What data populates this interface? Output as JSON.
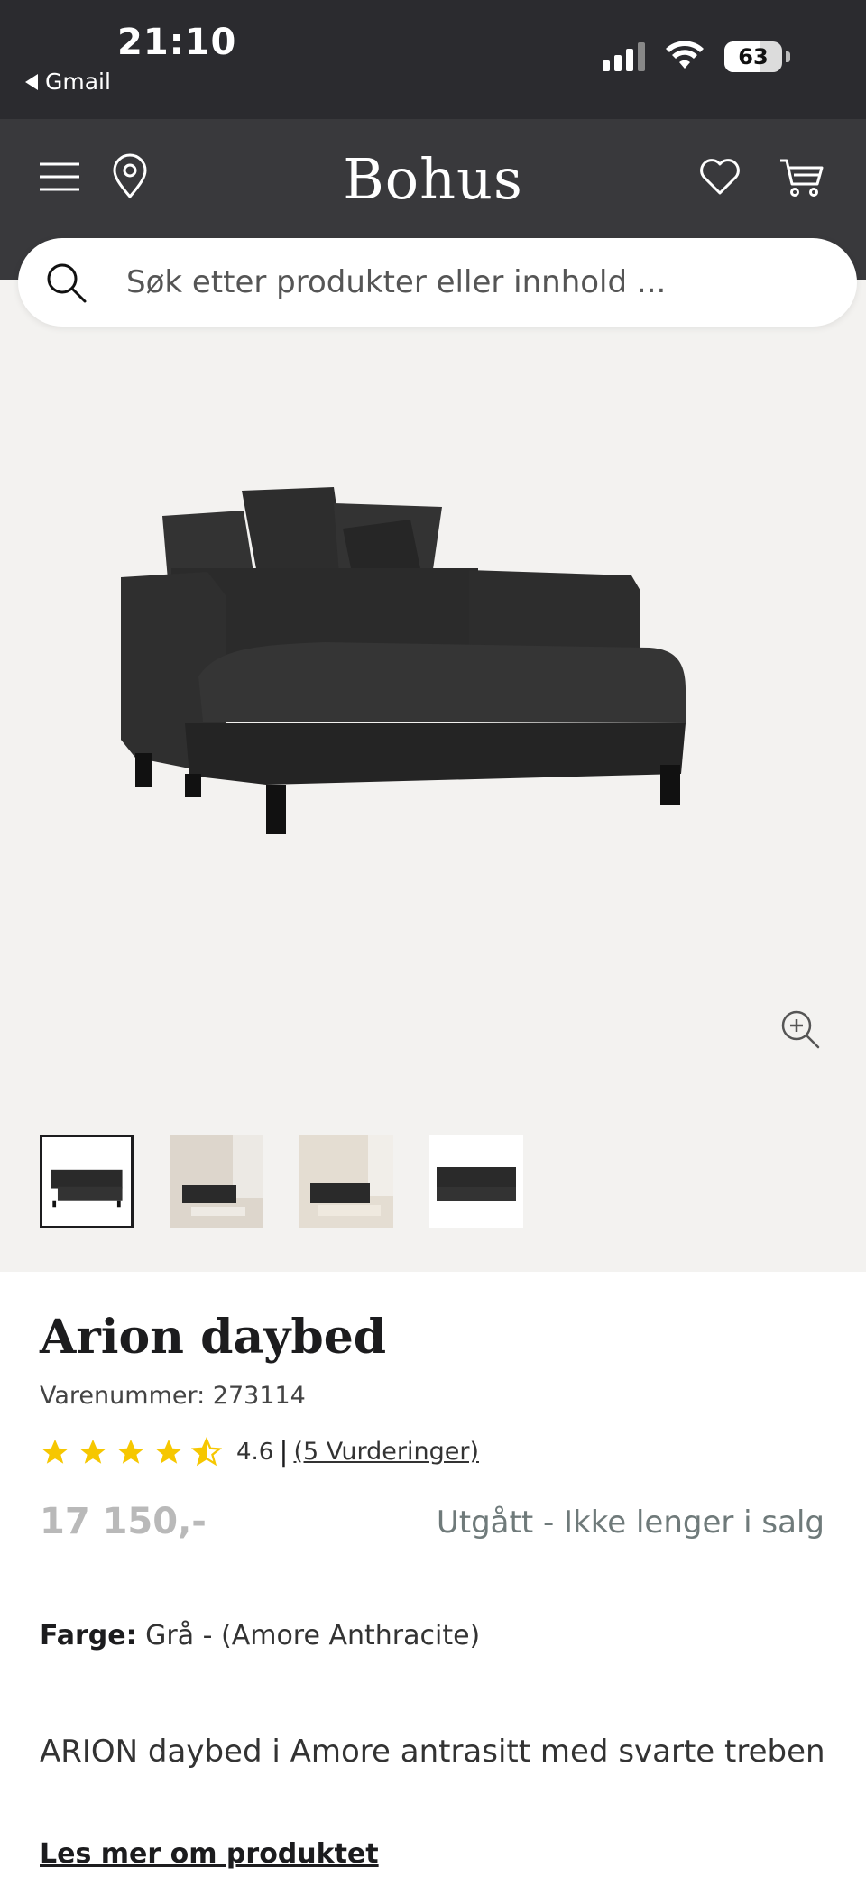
{
  "status_bar": {
    "time": "21:10",
    "back_app": "Gmail",
    "battery": "63"
  },
  "header": {
    "logo": "Bohus"
  },
  "search": {
    "placeholder": "Søk etter produkter eller innhold ..."
  },
  "product": {
    "title": "Arion daybed",
    "sku": "Varenummer: 273114",
    "rating_value": "4.6",
    "rating_separator": "|",
    "rating_count_link": "(5 Vurderinger)",
    "rating_stars": 4.5,
    "price": "17 150,-",
    "availability": "Utgått - Ikke lenger i salg",
    "color_label": "Farge:",
    "color_value": "Grå - (Amore Anthracite)",
    "description": "ARION daybed i Amore antrasitt med svarte treben",
    "read_more": "Les mer om produktet"
  },
  "colors": {
    "header_bg": "#39393c",
    "status_bg": "#2b2b2f",
    "gallery_bg": "#f3f2f0",
    "star": "#f6c700",
    "price_disabled": "#b9b9b9",
    "availability": "#6f7a7a"
  }
}
